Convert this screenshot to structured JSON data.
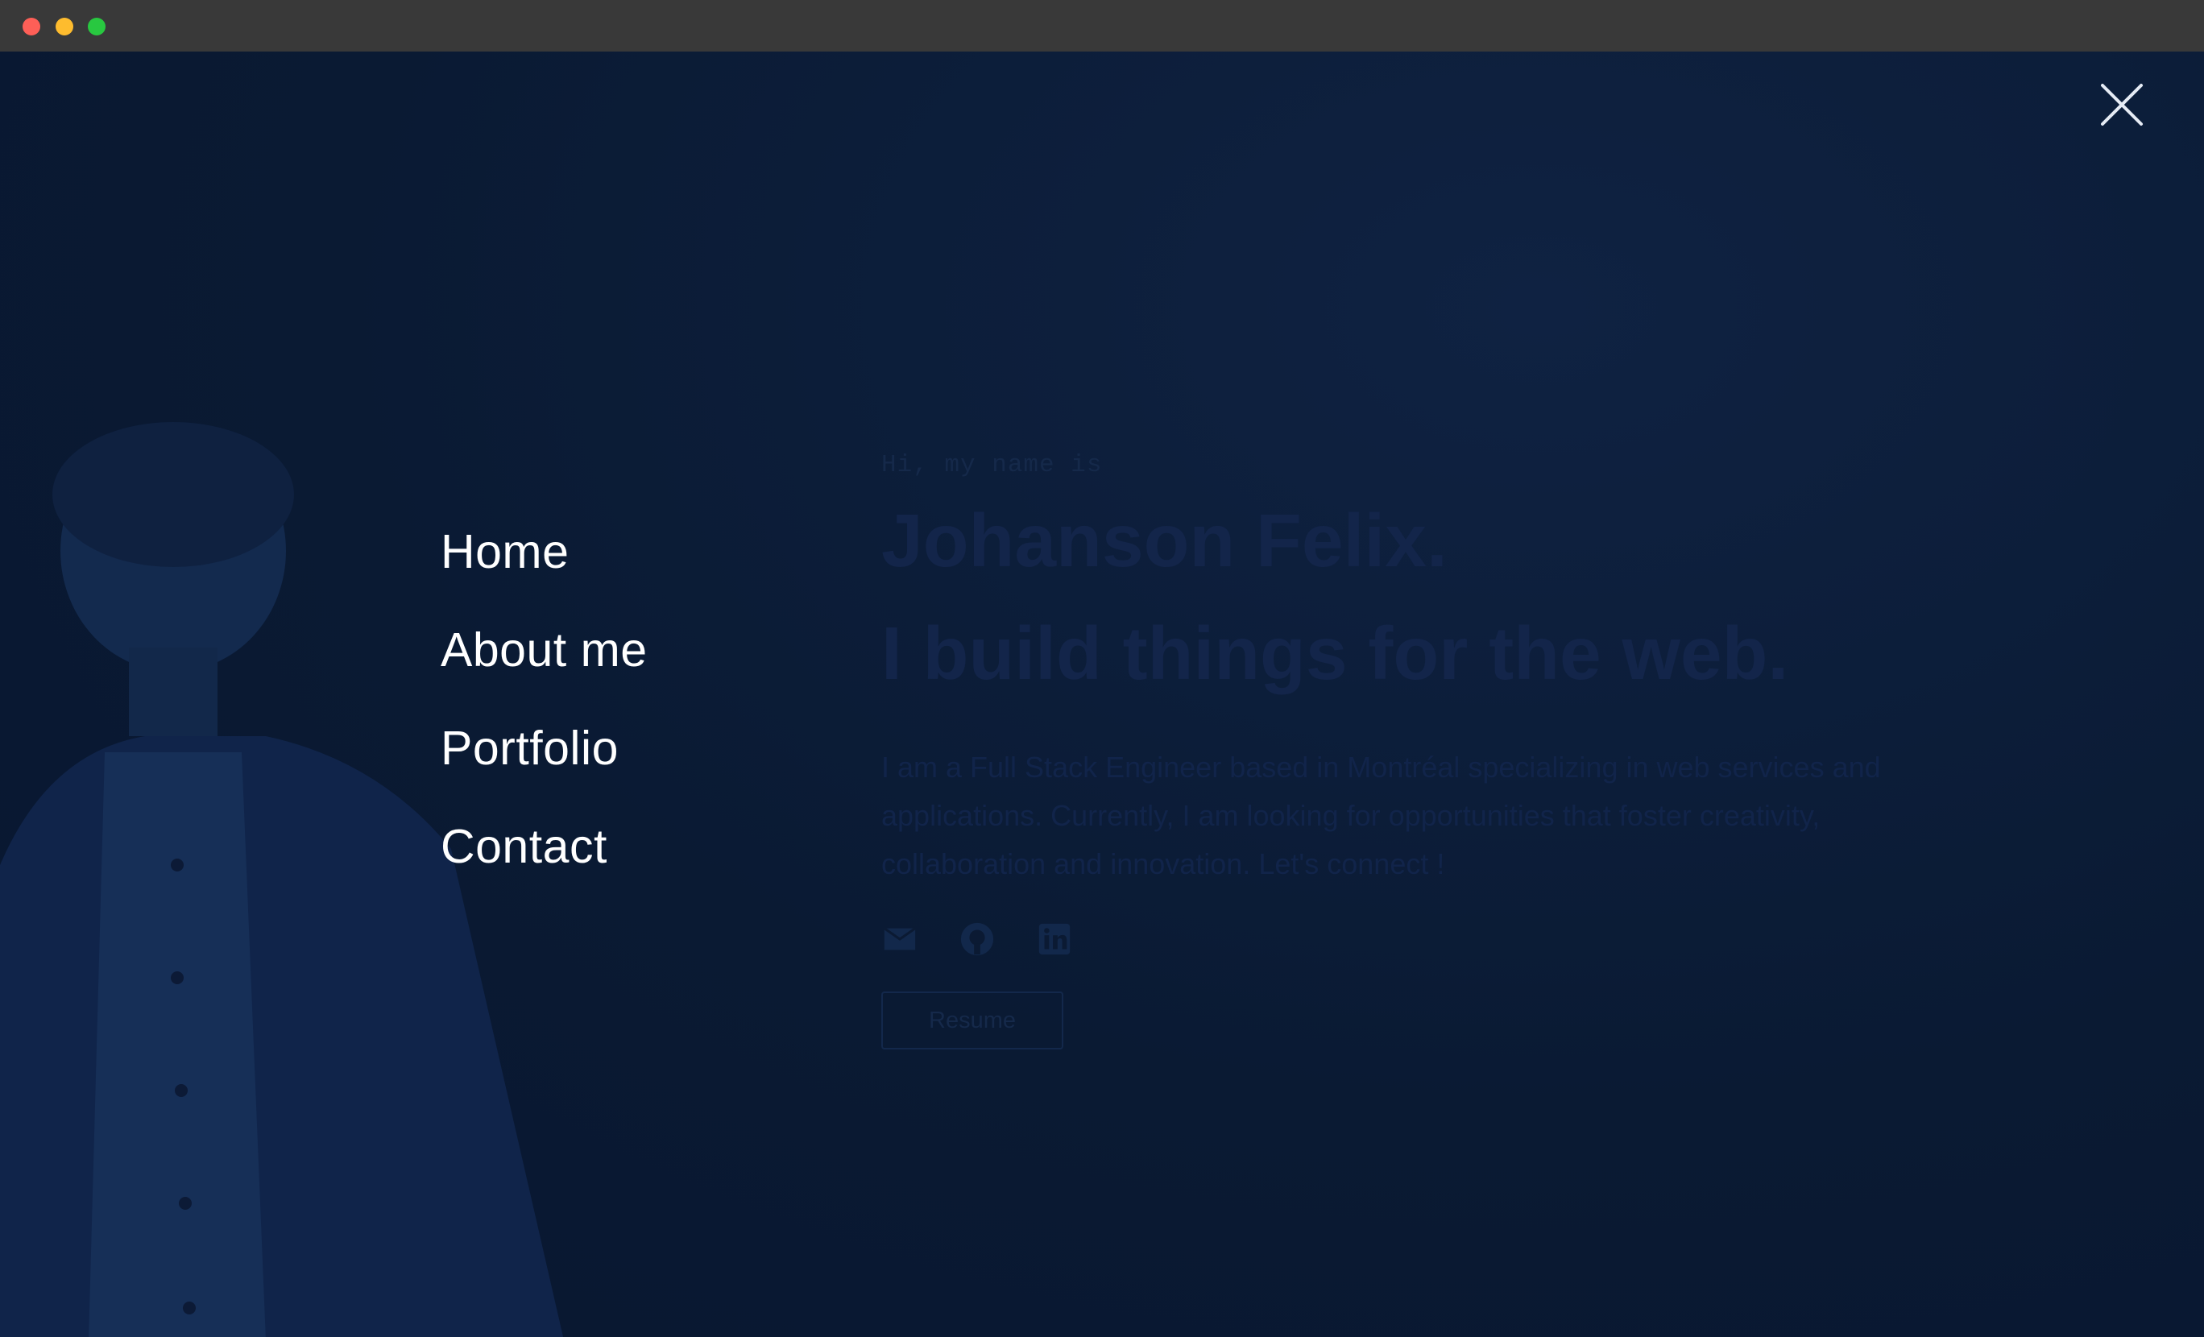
{
  "window": {
    "controls": [
      "close",
      "minimize",
      "maximize"
    ]
  },
  "close_button": {
    "icon": "close-icon"
  },
  "menu": {
    "items": [
      {
        "label": "Home"
      },
      {
        "label": "About me"
      },
      {
        "label": "Portfolio"
      },
      {
        "label": "Contact"
      }
    ]
  },
  "hero": {
    "greeting": "Hi, my name is",
    "name": "Johanson Felix.",
    "tagline": "I build things for the web.",
    "bio": "I am a Full Stack Engineer based in Montréal specializing in web services and applications. Currently, I am looking for opportunities that foster creativity, collaboration and innovation. Let's connect !",
    "socials": [
      {
        "icon": "mail-icon"
      },
      {
        "icon": "github-icon"
      },
      {
        "icon": "linkedin-icon"
      }
    ],
    "resume_label": "Resume"
  },
  "colors": {
    "overlay_bg": "#0b1a33",
    "menu_text": "#ffffff",
    "dim_text": "#13254a"
  }
}
